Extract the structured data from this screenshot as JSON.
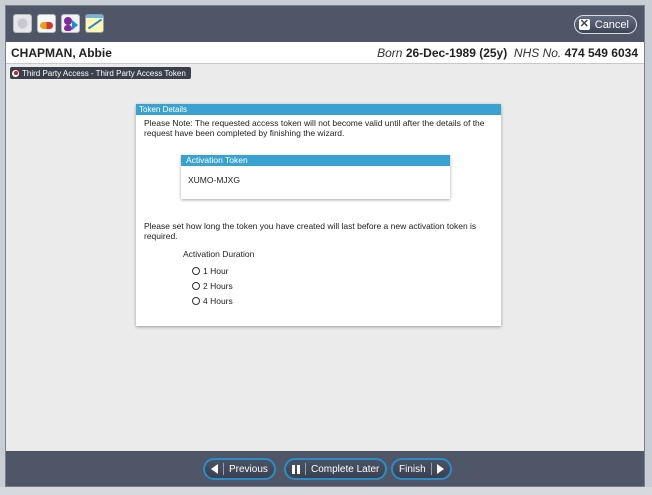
{
  "header": {
    "icons": [
      "settings-icon",
      "medication-icon",
      "patient-access-icon",
      "chart-icon"
    ],
    "cancel_label": "Cancel"
  },
  "patient": {
    "name": "CHAPMAN, Abbie",
    "born_label": "Born",
    "dob": "26-Dec-1989 (25y)",
    "nhs_label": "NHS No.",
    "nhs_number": "474 549 6034"
  },
  "breadcrumb": {
    "label": "Third Party Access - Third Party Access Token"
  },
  "token_details": {
    "title": "Token Details",
    "note": "Please Note:  The requested access token will not become valid until after the details of the request have been completed by finishing the wizard.",
    "activation_token": {
      "title": "Activation Token",
      "value": "XUMO-MJXG"
    },
    "duration_instruction": "Please set how long the token you have created will last before a new activation token is required.",
    "duration_label": "Activation Duration",
    "duration_options": [
      "1 Hour",
      "2 Hours",
      "4 Hours"
    ]
  },
  "footer": {
    "previous_label": "Previous",
    "complete_later_label": "Complete Later",
    "finish_label": "Finish"
  }
}
